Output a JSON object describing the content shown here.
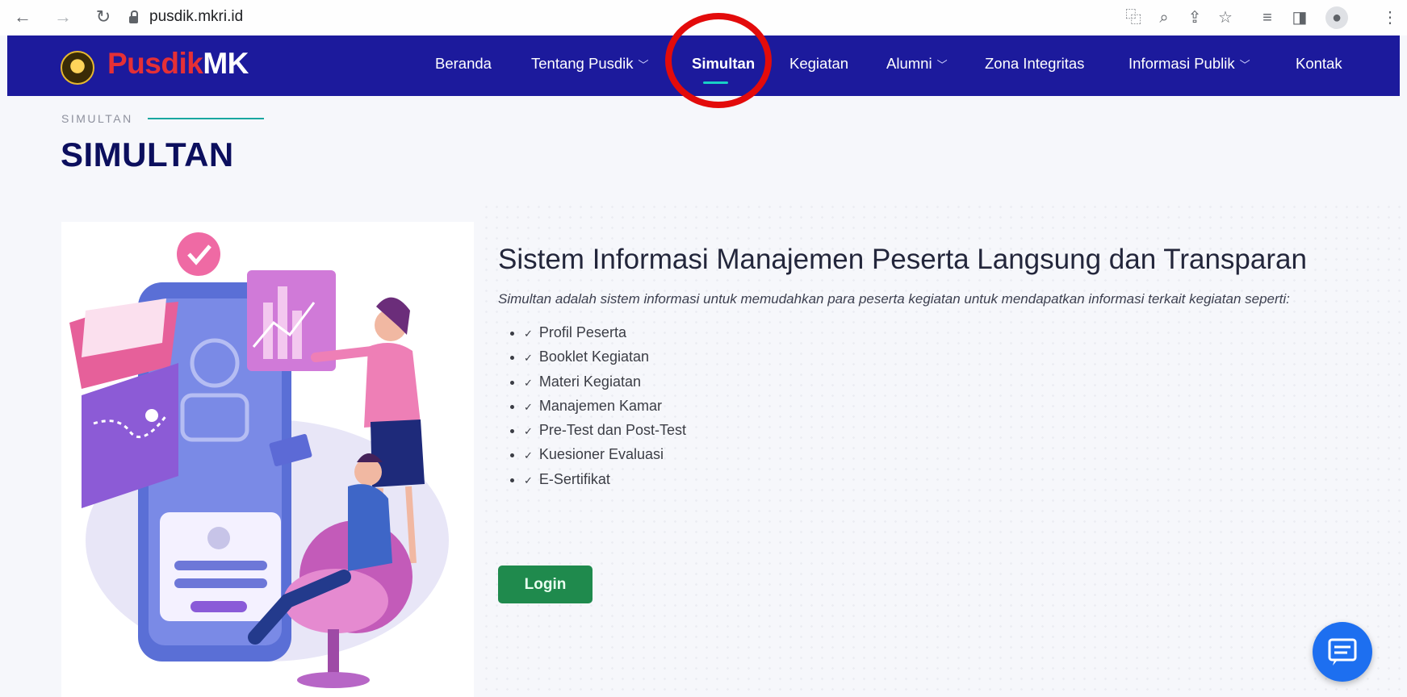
{
  "browser": {
    "url": "pusdik.mkri.id",
    "icons": [
      "back-icon",
      "forward-icon",
      "reload-icon",
      "lock-icon",
      "translate-icon",
      "zoom-icon",
      "share-icon",
      "star-icon",
      "reading-list-icon",
      "side-panel-icon",
      "profile-icon",
      "menu-icon"
    ]
  },
  "header": {
    "logo_part1": "Pusdik",
    "logo_part2": "MK",
    "nav": [
      {
        "label": "Beranda"
      },
      {
        "label": "Tentang Pusdik"
      },
      {
        "label": "Simultan"
      },
      {
        "label": "Kegiatan"
      },
      {
        "label": "Alumni"
      },
      {
        "label": "Zona Integritas"
      },
      {
        "label": "Informasi Publik"
      },
      {
        "label": "Kontak"
      }
    ],
    "active_nav": "Simultan",
    "colors": {
      "bar": "#1c1a9c",
      "accent": "#18d0c6",
      "logo_red": "#e53036"
    }
  },
  "breadcrumb": "SIMULTAN",
  "page_title": "SIMULTAN",
  "main": {
    "headline": "Sistem Informasi Manajemen Peserta Langsung dan Transparan",
    "intro": "Simultan adalah sistem informasi untuk memudahkan para peserta kegiatan untuk mendapatkan informasi terkait kegiatan seperti:",
    "features": [
      "Profil Peserta",
      "Booklet Kegiatan",
      "Materi Kegiatan",
      "Manajemen Kamar",
      "Pre-Test dan Post-Test",
      "Kuesioner Evaluasi",
      "E-Sertifikat"
    ],
    "login_label": "Login",
    "login_color": "#1f8a4d"
  },
  "chat_icon": "chat-icon"
}
